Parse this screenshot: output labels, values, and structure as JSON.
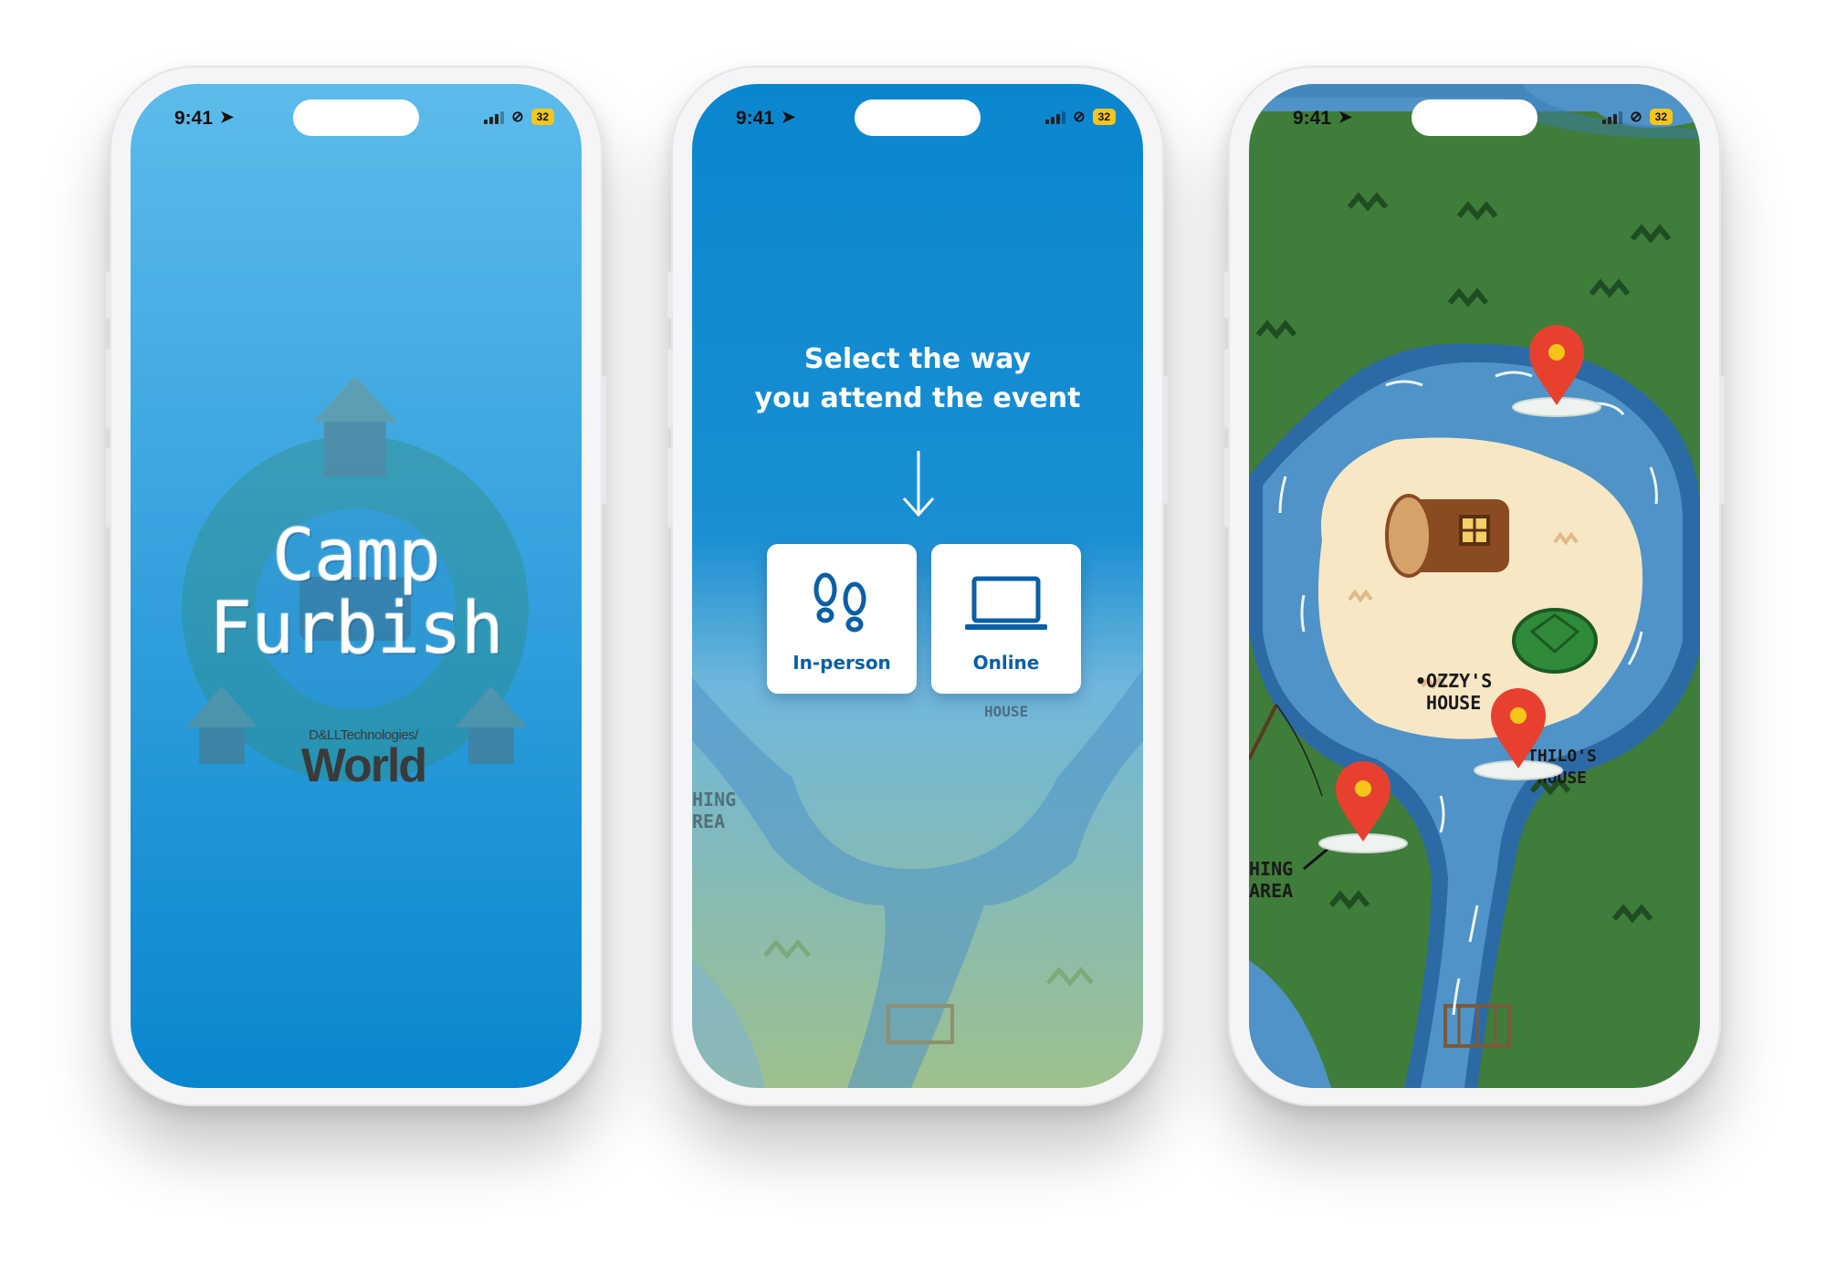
{
  "status_bar": {
    "time": "9:41",
    "battery": "32"
  },
  "screen1": {
    "title_line1": "Camp",
    "title_line2": "Furbish",
    "brand_small": "D&LLTechnologies/",
    "brand_big": "World"
  },
  "screen2": {
    "prompt_line1": "Select the way",
    "prompt_line2": "you attend the event",
    "options": [
      {
        "label": "In-person",
        "icon": "footprints-icon"
      },
      {
        "label": "Online",
        "icon": "laptop-icon"
      }
    ],
    "map_labels": {
      "house": "HOUSE",
      "fishing_line1": "HING",
      "fishing_line2": "REA"
    }
  },
  "screen3": {
    "labels": {
      "ozzy_line1": "•OZZY'S",
      "ozzy_line2": "HOUSE",
      "thilo_line1": "THILO'S",
      "thilo_line2": "HOUSE",
      "fishing_line1": "HING",
      "fishing_line2": "AREA"
    },
    "pins": [
      {
        "name": "pin-meadow",
        "icon": "map-pin-icon"
      },
      {
        "name": "pin-thilos-house",
        "icon": "map-pin-icon"
      },
      {
        "name": "pin-fishing-area",
        "icon": "map-pin-icon"
      }
    ]
  },
  "colors": {
    "sky_top": "#5ab8ea",
    "sky_bottom": "#0a87d0",
    "grass": "#3f7d3a",
    "river": "#4f93c8",
    "sand": "#f7e7c4",
    "pin_red": "#e8402f",
    "accent_blue": "#0a5fa6"
  }
}
